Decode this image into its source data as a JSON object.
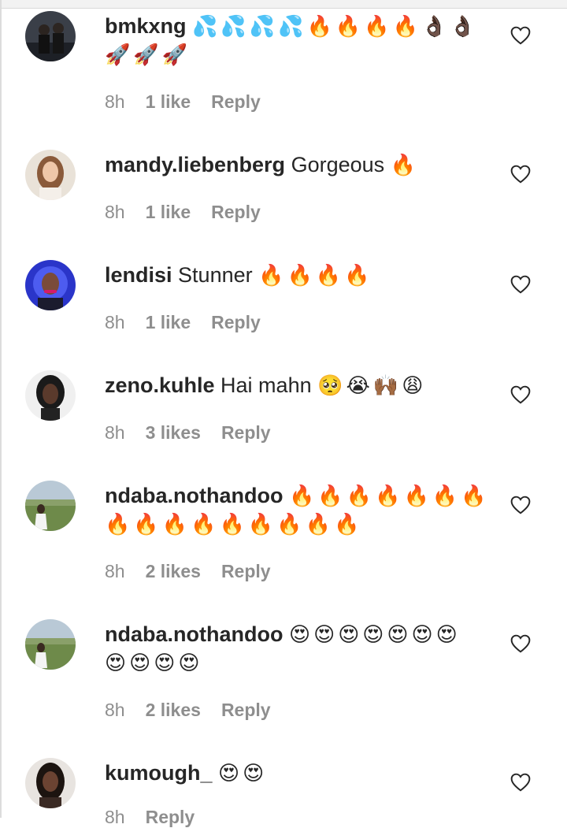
{
  "comments": [
    {
      "username": "bmkxng",
      "text": "",
      "emoji_line1": "💦💦💦💦🔥🔥🔥🔥👌🏿👌🏿",
      "emoji_line2": "🚀🚀🚀",
      "time": "8h",
      "likes": "1 like",
      "reply": "Reply"
    },
    {
      "username": "mandy.liebenberg",
      "text": "Gorgeous",
      "emoji_line1": "🔥",
      "emoji_line2": "",
      "time": "8h",
      "likes": "1 like",
      "reply": "Reply"
    },
    {
      "username": "lendisi",
      "text": "Stunner",
      "emoji_line1": "🔥🔥🔥🔥",
      "emoji_line2": "",
      "time": "8h",
      "likes": "1 like",
      "reply": "Reply"
    },
    {
      "username": "zeno.kuhle",
      "text": "Hai mahn",
      "emoji_line1": "🥺😭🙌🏾😩",
      "emoji_line2": "",
      "time": "8h",
      "likes": "3 likes",
      "reply": "Reply"
    },
    {
      "username": "ndaba.nothandoo",
      "text": "",
      "emoji_line1": "🔥🔥🔥🔥🔥🔥🔥",
      "emoji_line2": "🔥🔥🔥🔥🔥🔥🔥🔥🔥",
      "time": "8h",
      "likes": "2 likes",
      "reply": "Reply"
    },
    {
      "username": "ndaba.nothandoo",
      "text": "",
      "emoji_line1": "😍😍😍😍😍😍😍",
      "emoji_line2": "😍😍😍😍",
      "time": "8h",
      "likes": "2 likes",
      "reply": "Reply"
    },
    {
      "username": "kumough_",
      "text": "",
      "emoji_line1": "😍😍",
      "emoji_line2": "",
      "time": "8h",
      "likes": "",
      "reply": "Reply"
    }
  ],
  "colors": {
    "username": "#262626",
    "meta": "#8e8e8e",
    "background": "#ffffff"
  },
  "icons": {
    "like": "heart-outline-icon"
  }
}
